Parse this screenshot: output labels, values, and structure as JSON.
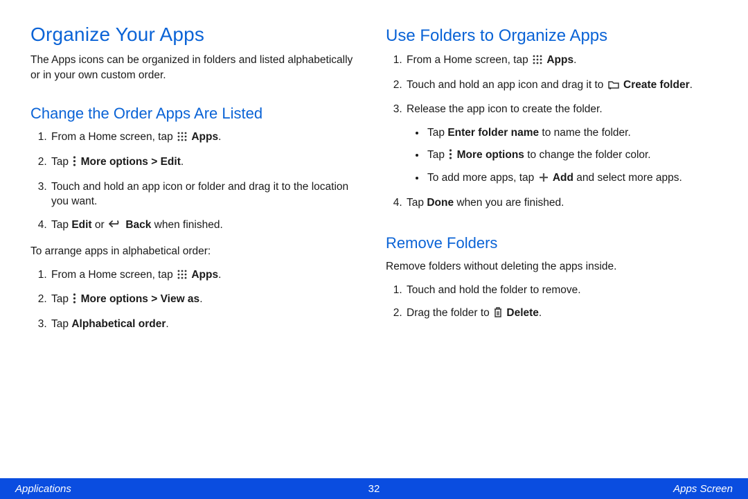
{
  "left": {
    "h1": "Organize Your Apps",
    "intro": "The Apps icons can be organized in folders and listed alphabetically or in your own custom order.",
    "h2a": "Change the Order Apps Are Listed",
    "s1_1a": "From a Home screen, tap ",
    "s1_1b": "Apps",
    "s1_1c": ".",
    "s1_2a": "Tap ",
    "s1_2b": "More options > Edit",
    "s1_2c": ".",
    "s1_3": "Touch and hold an app icon or folder and drag it to the location you want.",
    "s1_4a": "Tap ",
    "s1_4b": "Edit",
    "s1_4c": " or ",
    "s1_4d": "Back",
    "s1_4e": " when finished.",
    "para2": "To arrange apps in alphabetical order:",
    "s2_1a": "From a Home screen, tap ",
    "s2_1b": "Apps",
    "s2_1c": ".",
    "s2_2a": "Tap ",
    "s2_2b": "More options > View as",
    "s2_2c": ".",
    "s2_3a": "Tap ",
    "s2_3b": "Alphabetical order",
    "s2_3c": "."
  },
  "right": {
    "h2a": "Use Folders to Organize Apps",
    "r1_1a": "From a Home screen, tap ",
    "r1_1b": "Apps",
    "r1_1c": ".",
    "r1_2a": "Touch and hold an app icon and drag it to ",
    "r1_2b": "Create folder",
    "r1_2c": ".",
    "r1_3": "Release the app icon to create the folder.",
    "b1a": "Tap ",
    "b1b": "Enter folder name",
    "b1c": " to name the folder.",
    "b2a": "Tap ",
    "b2b": "More options",
    "b2c": " to change the folder color.",
    "b3a": "To add more apps, tap ",
    "b3b": "Add",
    "b3c": " and select more apps.",
    "r1_4a": "Tap ",
    "r1_4b": "Done",
    "r1_4c": " when you are finished.",
    "h2b": "Remove Folders",
    "rem_intro": "Remove folders without deleting the apps inside.",
    "rm1": "Touch and hold the folder to remove.",
    "rm2a": "Drag the folder to ",
    "rm2b": "Delete",
    "rm2c": "."
  },
  "footer": {
    "left": "Applications",
    "page": "32",
    "right": "Apps Screen"
  }
}
